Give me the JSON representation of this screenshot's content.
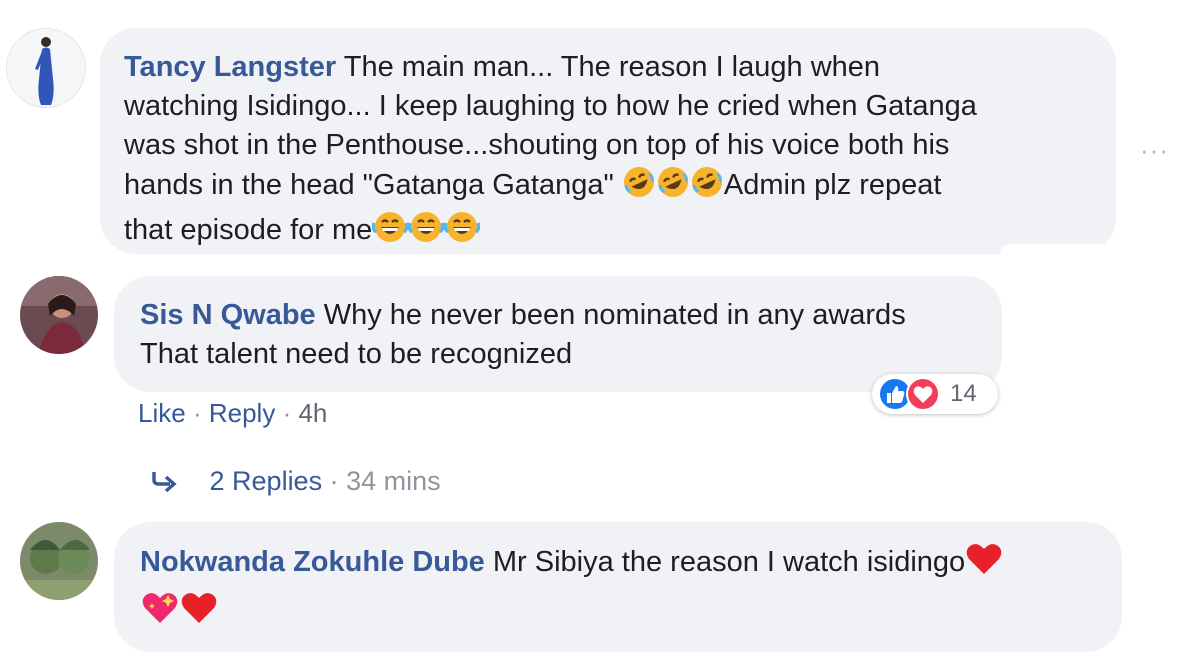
{
  "comments": [
    {
      "author": "Tancy Langster",
      "lines": [
        "The main man... The reason I laugh when",
        "watching Isidingo... I keep laughing to how he cried when Gatanga",
        "was shot in the Penthouse...shouting on top of his voice both his",
        "hands in the head \"Gatanga Gatanga\"",
        "Admin plz repeat",
        "that episode for me"
      ]
    },
    {
      "author": "Sis N Qwabe",
      "lines": [
        "Why he never been nominated in any awards",
        "That talent need to be recognized"
      ],
      "actions": {
        "like": "Like",
        "reply": "Reply",
        "sep": "·",
        "time": "4h"
      },
      "reaction_count": "14",
      "replies": {
        "label": "2 Replies",
        "sep": "·",
        "time": "34 mins"
      }
    },
    {
      "author": "Nokwanda Zokuhle Dube",
      "lines": [
        "Mr Sibiya the reason I watch isidingo"
      ]
    }
  ],
  "more_options": "···",
  "colors": {
    "author": "#385898",
    "bubble": "#f0f2f5",
    "like": "#1877f2",
    "love": "#f33e58"
  },
  "icons": [
    "rofl-emoji",
    "joy-emoji",
    "red-heart-emoji",
    "sparkling-heart-emoji",
    "like-reaction-icon",
    "love-reaction-icon",
    "reply-arrow-icon"
  ]
}
